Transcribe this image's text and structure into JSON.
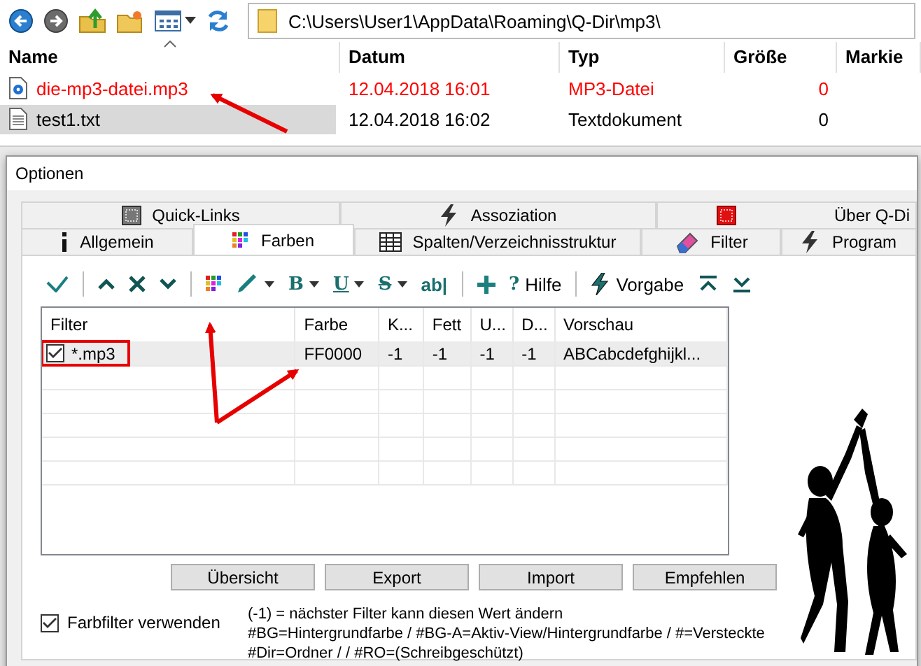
{
  "toolbar": {
    "icons": [
      {
        "kind": "back"
      },
      {
        "kind": "forward"
      },
      {
        "kind": "up"
      },
      {
        "kind": "new-folder"
      },
      {
        "kind": "view",
        "dropdown": true
      },
      {
        "kind": "refresh"
      }
    ],
    "address": "C:\\Users\\User1\\AppData\\Roaming\\Q-Dir\\mp3\\"
  },
  "file_list": {
    "columns": [
      "Name",
      "Datum",
      "Typ",
      "Größe",
      "Markie"
    ],
    "rows": [
      {
        "kind": "audio",
        "name": "die-mp3-datei.mp3",
        "date": "12.04.2018 16:01",
        "type": "MP3-Datei",
        "size": "0",
        "color": "#ff0000",
        "selected": false
      },
      {
        "kind": "text",
        "name": "test1.txt",
        "date": "12.04.2018 16:02",
        "type": "Textdokument",
        "size": "0",
        "color": "#000000",
        "selected": true
      }
    ]
  },
  "dialog": {
    "title": "Optionen",
    "tab_rows": [
      [
        {
          "kind": "grid",
          "label": "Quick-Links",
          "selected": false
        },
        {
          "kind": "bolt",
          "label": "Assoziation",
          "selected": false
        },
        {
          "kind": "red-grid",
          "label": "Über Q-Di",
          "selected": false
        }
      ],
      [
        {
          "kind": "info",
          "label": "Allgemein",
          "selected": false
        },
        {
          "kind": "palette",
          "label": "Farben",
          "selected": true
        },
        {
          "kind": "table",
          "label": "Spalten/Verzeichnisstruktur",
          "selected": false
        },
        {
          "kind": "eraser",
          "label": "Filter",
          "selected": false
        },
        {
          "kind": "bolt",
          "label": "Program",
          "selected": false
        }
      ]
    ],
    "toolbar": [
      {
        "kind": "check"
      },
      {
        "kind": "sep"
      },
      {
        "kind": "up"
      },
      {
        "kind": "cross"
      },
      {
        "kind": "down"
      },
      {
        "kind": "sep"
      },
      {
        "kind": "palette"
      },
      {
        "kind": "pen",
        "dropdown": true
      },
      {
        "kind": "bold",
        "glyph": "B",
        "dropdown": true
      },
      {
        "kind": "underline",
        "glyph": "U",
        "dropdown": true
      },
      {
        "kind": "strike",
        "glyph": "S",
        "dropdown": true
      },
      {
        "kind": "plain",
        "glyph": "ab|"
      },
      {
        "kind": "sep"
      },
      {
        "kind": "plus"
      },
      {
        "kind": "labeled",
        "glyph": "?",
        "label": "Hilfe"
      },
      {
        "kind": "sep"
      },
      {
        "kind": "bolt",
        "label": "Vorgabe"
      },
      {
        "kind": "top"
      },
      {
        "kind": "bottom"
      }
    ],
    "table": {
      "columns": [
        "Filter",
        "Farbe",
        "K...",
        "Fett",
        "U...",
        "D...",
        "Vorschau"
      ],
      "rows": [
        {
          "checked": true,
          "selected": true,
          "annotated": true,
          "cells": [
            "*.mp3",
            "FF0000",
            "-1",
            "-1",
            "-1",
            "-1",
            "ABCabcdefghijkl..."
          ]
        }
      ]
    },
    "buttons": [
      "Übersicht",
      "Export",
      "Import",
      "Empfehlen"
    ],
    "use_filter": {
      "label": "Farbfilter verwenden",
      "checked": true
    },
    "notes": [
      "(-1) = nächster Filter kann diesen Wert ändern",
      "#BG=Hintergrundfarbe / #BG-A=Aktiv-View/Hintergrundfarbe / #=Versteckte",
      "#Dir=Ordner / / #RO=(Schreibgeschützt)"
    ]
  }
}
